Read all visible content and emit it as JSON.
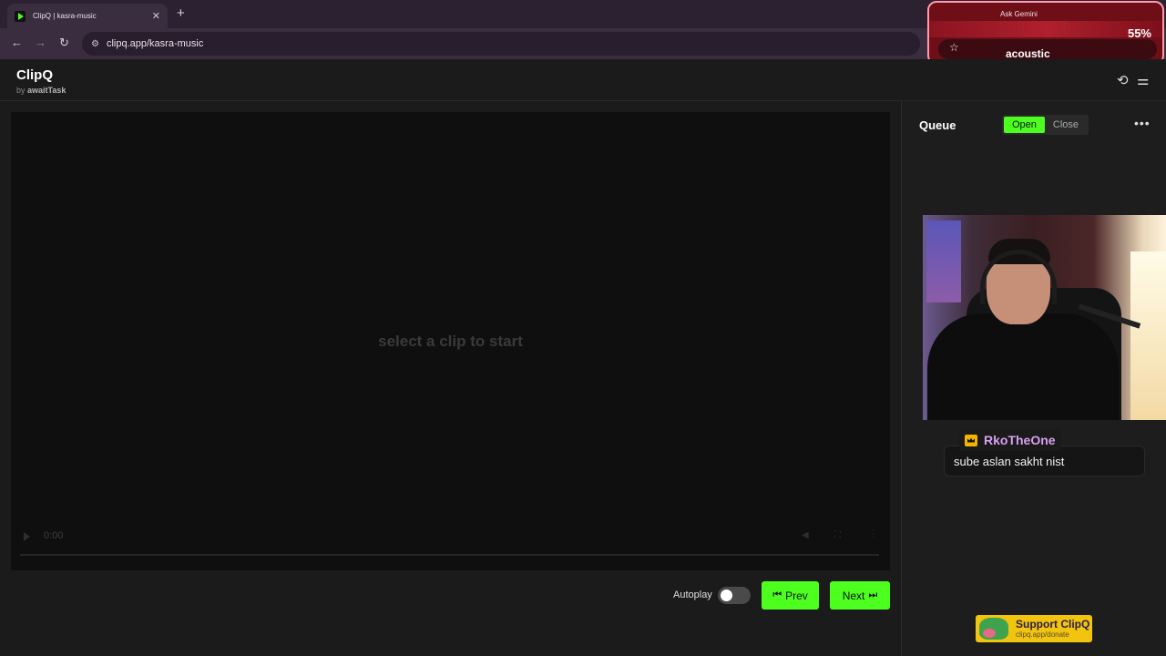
{
  "browser": {
    "tab_title": "ClipQ | kasra-music",
    "url": "clipq.app/kasra-music"
  },
  "overlay": {
    "gemini_label": "Ask Gemini",
    "percent": "55%",
    "label": "acoustic"
  },
  "app": {
    "brand": "ClipQ",
    "by_prefix": "by",
    "by_author": "awaitTask"
  },
  "player": {
    "empty_message": "select a clip to start",
    "time": "0:00"
  },
  "controls": {
    "autoplay_label": "Autoplay",
    "autoplay_on": false,
    "prev_label": "Prev",
    "next_label": "Next"
  },
  "sidebar": {
    "title": "Queue",
    "open_label": "Open",
    "close_label": "Close",
    "active": "Open"
  },
  "chat": {
    "username": "RkoTheOne",
    "message": "sube aslan sakht nist"
  },
  "support": {
    "title": "Support ClipQ",
    "url": "clipq.app/donate"
  },
  "colors": {
    "accent": "#4cff1e",
    "background": "#1b1b1b",
    "support": "#f1c40f",
    "username": "#d8a0f0"
  }
}
